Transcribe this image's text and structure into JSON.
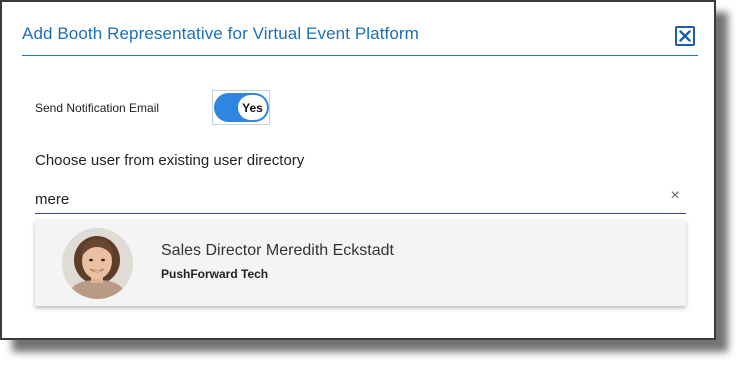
{
  "dialog": {
    "title": "Add Booth Representative for Virtual Event Platform",
    "close_icon": "close-icon"
  },
  "notification": {
    "label": "Send Notification Email",
    "toggle_value": "Yes",
    "toggle_on": true
  },
  "user_search": {
    "label": "Choose user from existing user directory",
    "value": "mere",
    "clear_icon": "clear-icon",
    "clear_glyph": "×"
  },
  "results": [
    {
      "name": "Sales Director Meredith Eckstadt",
      "company": "PushForward Tech",
      "avatar_icon": "avatar"
    }
  ],
  "colors": {
    "accent": "#2f86e0",
    "title": "#1b6fb8",
    "rule": "#1e78c4"
  }
}
